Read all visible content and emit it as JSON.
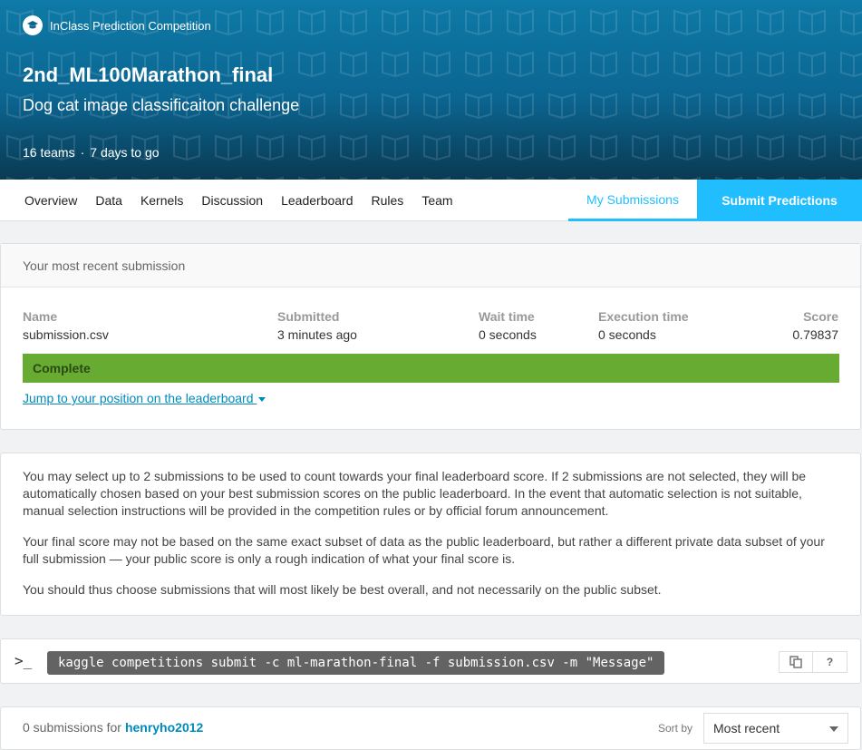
{
  "header": {
    "badge": "InClass Prediction Competition",
    "title": "2nd_ML100Marathon_final",
    "subtitle": "Dog cat image classificaiton challenge",
    "teams": "16 teams",
    "separator": "·",
    "time_left": "7 days to go"
  },
  "nav": {
    "items": [
      "Overview",
      "Data",
      "Kernels",
      "Discussion",
      "Leaderboard",
      "Rules",
      "Team"
    ],
    "my_submissions": "My Submissions",
    "submit": "Submit Predictions",
    "active_color": "#20beff"
  },
  "recent": {
    "heading": "Your most recent submission",
    "columns": {
      "name": {
        "label": "Name",
        "value": "submission.csv"
      },
      "submitted": {
        "label": "Submitted",
        "value": "3 minutes ago"
      },
      "wait": {
        "label": "Wait time",
        "value": "0 seconds"
      },
      "execution": {
        "label": "Execution time",
        "value": "0 seconds"
      },
      "score": {
        "label": "Score",
        "value": "0.79837"
      }
    },
    "status": "Complete",
    "status_color": "#67ab33",
    "jump_link": "Jump to your position on the leaderboard"
  },
  "info": {
    "paragraphs": [
      "You may select up to 2 submissions to be used to count towards your final leaderboard score. If 2 submissions are not selected, they will be automatically chosen based on your best submission scores on the public leaderboard. In the event that automatic selection is not suitable, manual selection instructions will be provided in the competition rules or by official forum announcement.",
      "Your final score may not be based on the same exact subset of data as the public leaderboard, but rather a different private data subset of your full submission — your public score is only a rough indication of what your final score is.",
      "You should thus choose submissions that will most likely be best overall, and not necessarily on the public subset."
    ]
  },
  "cli": {
    "prompt": ">_",
    "command": "kaggle competitions submit -c ml-marathon-final -f submission.csv -m \"Message\"",
    "help": "?"
  },
  "submissions": {
    "count_text": "0 submissions for",
    "user": "henryho2012",
    "sort_label": "Sort by",
    "sort_value": "Most recent"
  }
}
